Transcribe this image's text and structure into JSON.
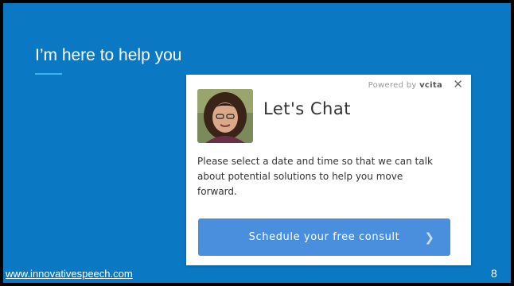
{
  "slide": {
    "title": "I’m here to help you",
    "footer_link": "www.innovativespeech.com",
    "page_number": "8"
  },
  "widget": {
    "powered_by_prefix": "Powered by",
    "powered_by_brand": "vcita",
    "close_symbol": "✕",
    "heading": "Let's Chat",
    "description": "Please select a date and time so that we can talk about potential solutions to help you move forward.",
    "cta_label": "Schedule your free consult",
    "cta_icon": "chevron-right-icon",
    "avatar_icon": "profile-photo"
  },
  "colors": {
    "slide_background": "#0a78c2",
    "title_accent": "#3fb6e8",
    "cta_button": "#4a8fdd",
    "widget_background": "#ffffff"
  }
}
